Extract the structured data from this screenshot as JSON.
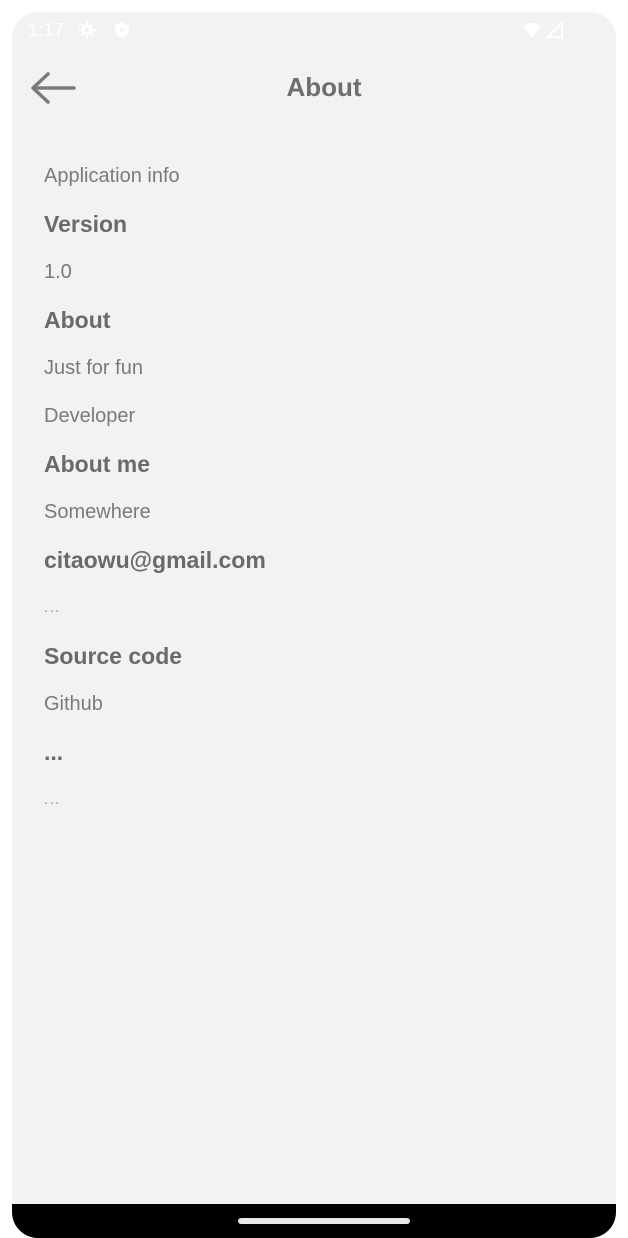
{
  "status_bar": {
    "time": "1:17",
    "icons": [
      "gear-icon",
      "shield-icon",
      "wifi-icon",
      "signal-icon"
    ]
  },
  "app_bar": {
    "title": "About",
    "back_icon": "arrow-left-icon"
  },
  "sections": [
    {
      "type": "sub",
      "text": "Application info"
    },
    {
      "type": "head",
      "text": "Version"
    },
    {
      "type": "sub",
      "text": "1.0"
    },
    {
      "type": "head",
      "text": "About"
    },
    {
      "type": "sub",
      "text": "Just for fun"
    },
    {
      "type": "sub",
      "text": "Developer"
    },
    {
      "type": "head",
      "text": "About me"
    },
    {
      "type": "sub",
      "text": "Somewhere"
    },
    {
      "type": "head",
      "text": "citaowu@gmail.com"
    },
    {
      "type": "faint",
      "text": "..."
    },
    {
      "type": "head",
      "text": "Source code"
    },
    {
      "type": "sub",
      "text": "Github"
    },
    {
      "type": "head",
      "text": "..."
    },
    {
      "type": "faint",
      "text": "..."
    }
  ],
  "colors": {
    "background": "#f2f2f2",
    "text_primary": "#6a6a6a",
    "text_secondary": "#7a7a7a",
    "nav_bar": "#000000"
  }
}
